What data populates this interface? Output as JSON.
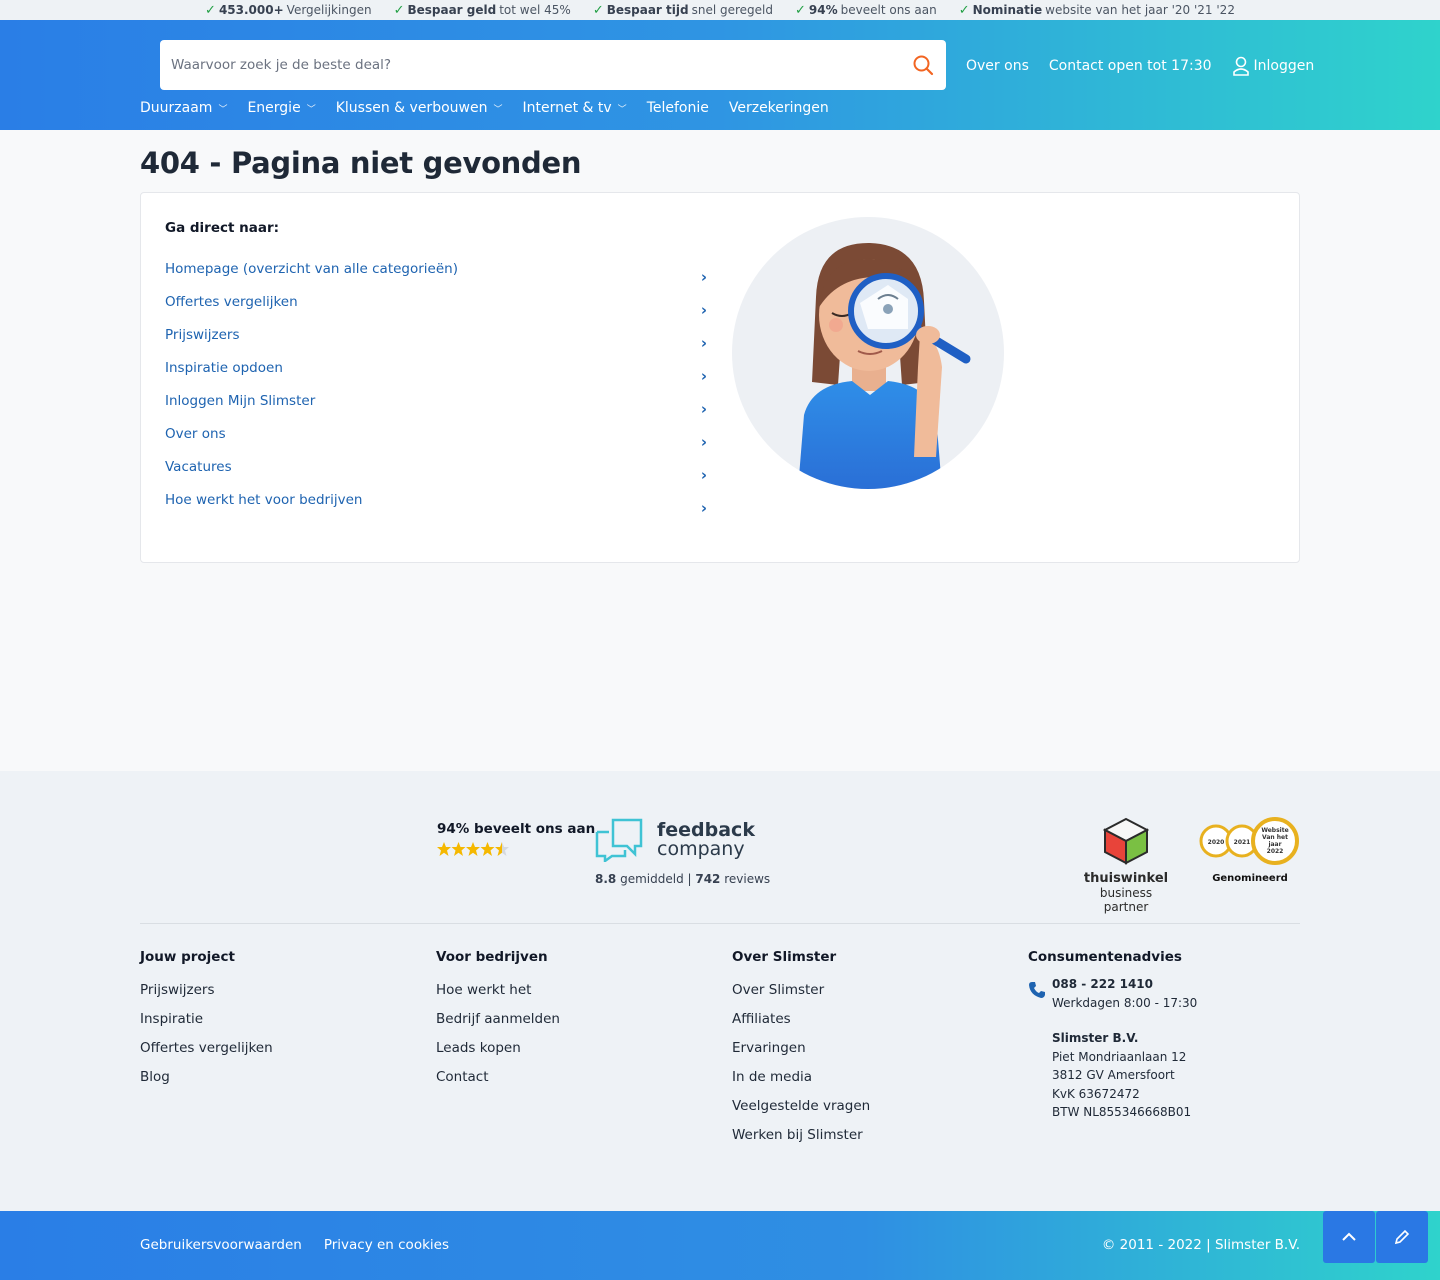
{
  "usp": [
    {
      "bold": "453.000+",
      "text": " Vergelijkingen"
    },
    {
      "bold": "Bespaar geld",
      "text": " tot wel 45%"
    },
    {
      "bold": "Bespaar tijd",
      "text": " snel geregeld"
    },
    {
      "bold": "94%",
      "text": " beveelt ons aan"
    },
    {
      "bold": "Nominatie",
      "text": " website van het jaar '20 '21 '22"
    }
  ],
  "search": {
    "placeholder": "Waarvoor zoek je de beste deal?"
  },
  "top_links": {
    "about": "Over ons",
    "contact": "Contact open tot 17:30",
    "login": "Inloggen"
  },
  "nav": [
    "Duurzaam",
    "Energie",
    "Klussen & verbouwen",
    "Internet & tv",
    "Telefonie",
    "Verzekeringen"
  ],
  "page": {
    "title": "404 - Pagina niet gevonden",
    "direct_heading": "Ga direct naar:",
    "links": [
      "Homepage (overzicht van alle categorieën)",
      "Offertes vergelijken",
      "Prijswijzers",
      "Inspiratie opdoen",
      "Inloggen Mijn Slimster",
      "Over ons",
      "Vacatures",
      "Hoe werkt het voor bedrijven"
    ]
  },
  "footer": {
    "rating_title": "94% beveelt ons aan",
    "stars": 4.5,
    "fbc_word1": "feedback",
    "fbc_word2": "company",
    "fbc_score": "8.8",
    "fbc_avg": "gemiddeld",
    "fbc_reviews": "742",
    "fbc_reviews_label": "reviews",
    "thuis_1": "thuiswinkel",
    "thuis_2": "business partner",
    "award_years": [
      "2020",
      "2021"
    ],
    "award_text": [
      "Website",
      "Van het",
      "jaar",
      "2022"
    ],
    "award_label": "Genomineerd",
    "columns": [
      {
        "title": "Jouw project",
        "links": [
          "Prijswijzers",
          "Inspiratie",
          "Offertes vergelijken",
          "Blog"
        ]
      },
      {
        "title": "Voor bedrijven",
        "links": [
          "Hoe werkt het",
          "Bedrijf aanmelden",
          "Leads kopen",
          "Contact"
        ]
      },
      {
        "title": "Over Slimster",
        "links": [
          "Over Slimster",
          "Affiliates",
          "Ervaringen",
          "In de media",
          "Veelgestelde vragen",
          "Werken bij Slimster"
        ]
      }
    ],
    "contact": {
      "title": "Consumentenadvies",
      "phone": "088 - 222 1410",
      "hours": "Werkdagen 8:00 - 17:30",
      "company": "Slimster B.V.",
      "address": [
        "Piet Mondriaanlaan 12",
        "3812 GV Amersfoort",
        "KvK 63672472",
        "BTW NL855346668B01"
      ]
    },
    "bottom_links": [
      "Gebruikersvoorwaarden",
      "Privacy en cookies"
    ],
    "copyright": "© 2011 - 2022 | Slimster B.V."
  },
  "colors": {
    "brand_blue": "#2a7ee6",
    "brand_teal": "#2fd3cc",
    "link": "#1e63b0",
    "check": "#22a045",
    "search_icon": "#f26522"
  },
  "icons": [
    "check-icon",
    "search-icon",
    "user-icon",
    "chevron-down-icon",
    "chevron-right-icon",
    "phone-icon",
    "arrow-up-icon",
    "pencil-icon"
  ]
}
